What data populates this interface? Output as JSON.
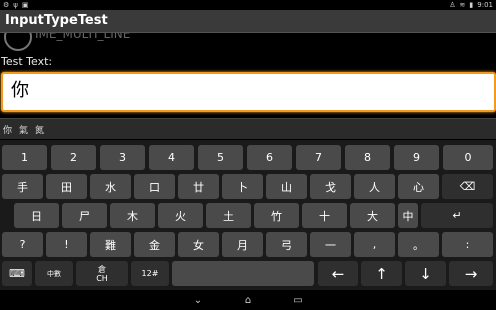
{
  "status": {
    "left_icons": [
      "settings-icon",
      "usb-icon",
      "debug-icon"
    ],
    "time": "9:01",
    "right_icons": [
      "android-icon",
      "wifi-icon",
      "battery-icon"
    ]
  },
  "app": {
    "title": "InputTypeTest",
    "ghost_text": "IME_MULTI_LINE"
  },
  "form": {
    "label": "Test Text:",
    "value": "你"
  },
  "candidates": [
    "你",
    "氣",
    "氮"
  ],
  "keyboard": {
    "rows": [
      [
        "1",
        "2",
        "3",
        "4",
        "5",
        "6",
        "7",
        "8",
        "9",
        "0"
      ],
      [
        "手",
        "田",
        "水",
        "口",
        "廿",
        "卜",
        "山",
        "戈",
        "人",
        "心",
        "⌫"
      ],
      [
        "日",
        "尸",
        "木",
        "火",
        "土",
        "竹",
        "十",
        "大",
        "中",
        "↵"
      ],
      [
        "?",
        "!",
        "難",
        "金",
        "女",
        "月",
        "弓",
        "一",
        ",",
        "。",
        ":"
      ],
      [
        "⌨",
        "中數",
        "倉\nCH",
        "12#",
        "",
        "←",
        "↑",
        "↓",
        "→"
      ]
    ]
  },
  "navigation": {
    "back": "back-icon",
    "home": "home-icon",
    "recents": "recents-icon"
  }
}
